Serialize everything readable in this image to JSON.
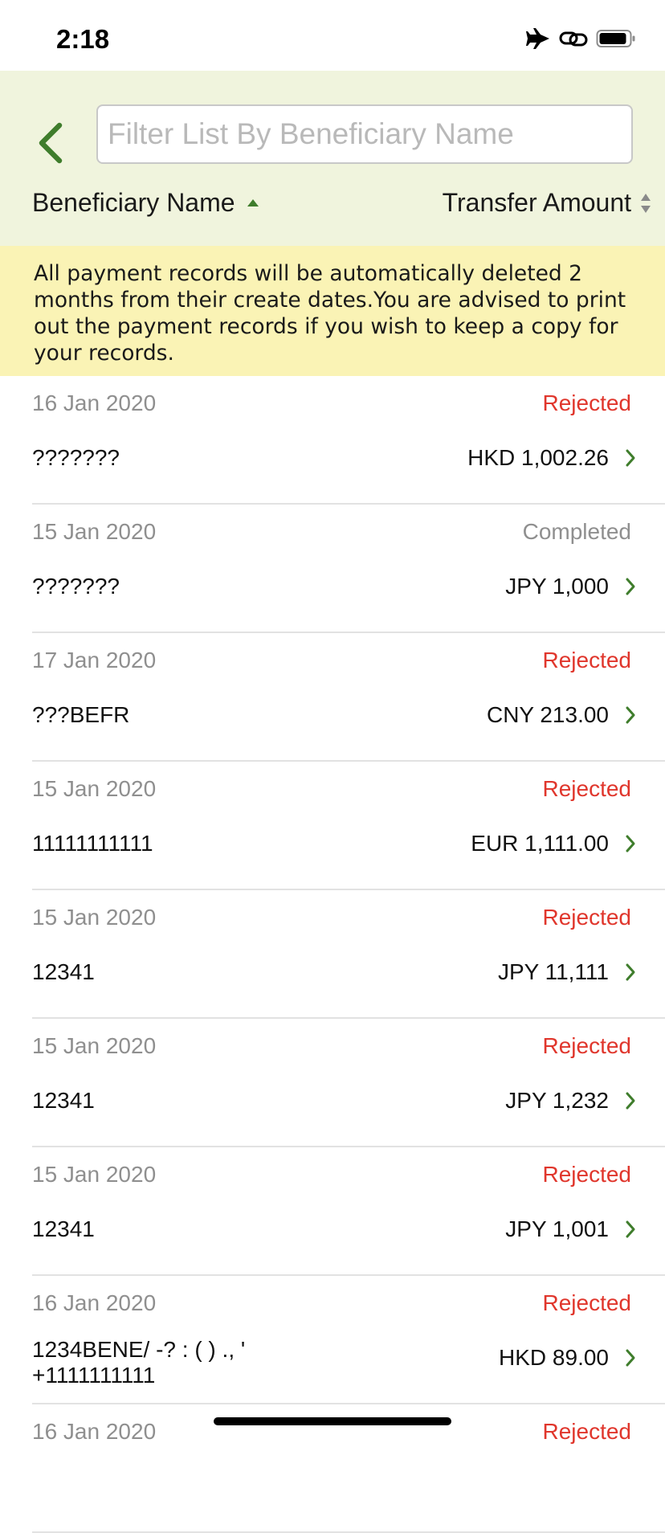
{
  "status_bar": {
    "time": "2:18"
  },
  "header": {
    "search_placeholder": "Filter List By Beneficiary Name",
    "sort_name_label": "Beneficiary Name",
    "sort_amount_label": "Transfer Amount"
  },
  "notice": {
    "text": "All payment records will be automatically deleted 2 months from their create dates.You are advised to print out the payment records if you wish to keep a copy for your records."
  },
  "colors": {
    "accent": "#3f7d2c",
    "rejected": "#e0362c",
    "completed": "#8f8f8f",
    "header_bg": "#f0f4dd",
    "notice_bg": "#faf3b5"
  },
  "records": [
    {
      "date": "16 Jan 2020",
      "status": "Rejected",
      "name": "???????",
      "amount": "HKD 1,002.26"
    },
    {
      "date": "15 Jan 2020",
      "status": "Completed",
      "name": "???????",
      "amount": "JPY 1,000"
    },
    {
      "date": "17 Jan 2020",
      "status": "Rejected",
      "name": "???BEFR",
      "amount": "CNY 213.00"
    },
    {
      "date": "15 Jan 2020",
      "status": "Rejected",
      "name": "11111111111",
      "amount": "EUR 1,111.00"
    },
    {
      "date": "15 Jan 2020",
      "status": "Rejected",
      "name": "12341",
      "amount": "JPY 11,111"
    },
    {
      "date": "15 Jan 2020",
      "status": "Rejected",
      "name": "12341",
      "amount": "JPY 1,232"
    },
    {
      "date": "15 Jan 2020",
      "status": "Rejected",
      "name": "12341",
      "amount": "JPY 1,001"
    },
    {
      "date": "16 Jan 2020",
      "status": "Rejected",
      "name": "1234BENE/ -? : ( ) ., '",
      "name_line2": "+1111111111",
      "amount": "HKD 89.00"
    },
    {
      "date": "16 Jan 2020",
      "status": "Rejected",
      "name": "",
      "amount": ""
    }
  ]
}
